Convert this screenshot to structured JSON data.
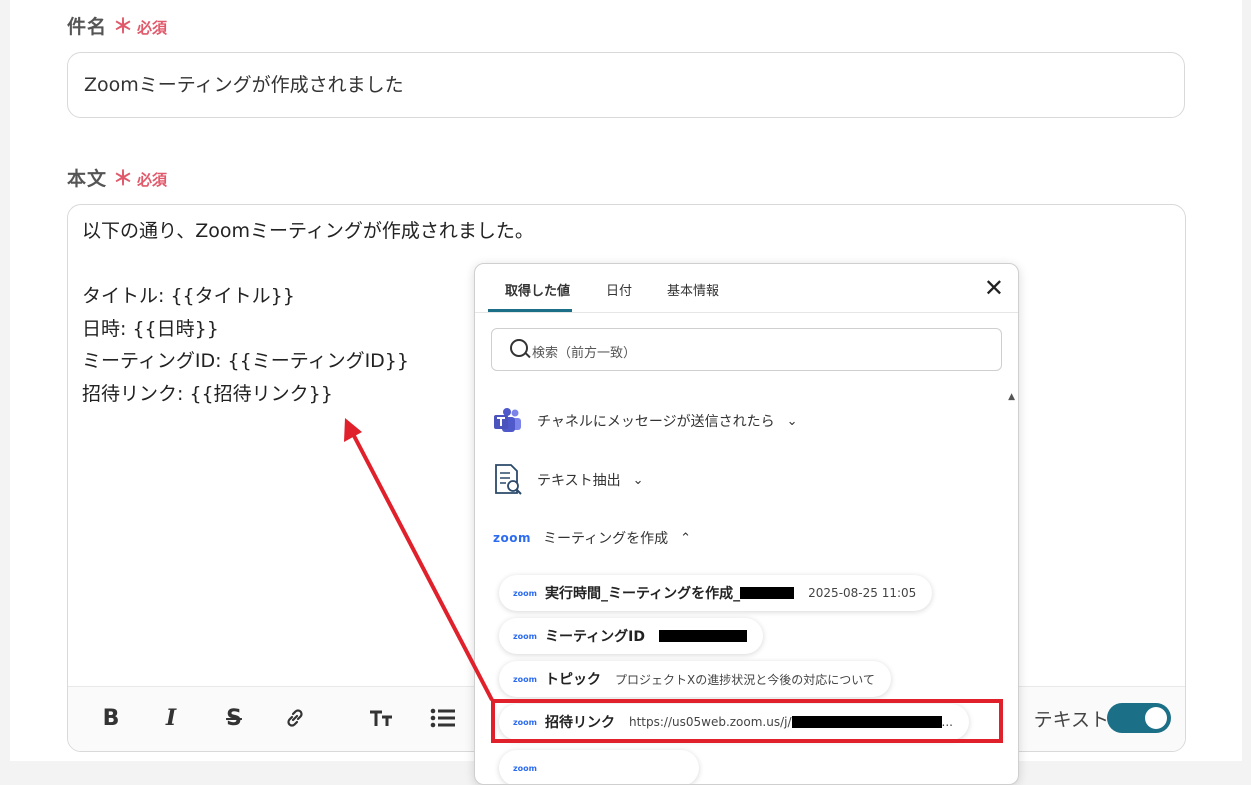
{
  "subject": {
    "label": "件名",
    "required_mark": "＊",
    "required_text": "必須",
    "value": "Zoomミーティングが作成されました"
  },
  "body": {
    "label": "本文",
    "required_mark": "＊",
    "required_text": "必須",
    "lines": [
      "以下の通り、Zoomミーティングが作成されました。",
      "",
      "タイトル: {{タイトル}}",
      "日時: {{日時}}",
      "ミーティングID: {{ミーティングID}}",
      "招待リンク: {{招待リンク}}"
    ]
  },
  "toolbar": {
    "bold_label": "B",
    "italic_label": "I",
    "strike_label": "S",
    "rich_text_label": "テキスト",
    "rich_text_on": true
  },
  "popup": {
    "tabs": [
      "取得した値",
      "日付",
      "基本情報"
    ],
    "close_glyph": "✕",
    "search_placeholder": "検索（前方一致）",
    "sections": [
      {
        "icon": "teams-icon",
        "title": "チャネルにメッセージが送信されたら",
        "expanded": false
      },
      {
        "icon": "document-search-icon",
        "title": "テキスト抽出",
        "expanded": false
      },
      {
        "icon": "zoom-logo",
        "logo_text": "zoom",
        "title": "ミーティングを作成",
        "expanded": true
      }
    ],
    "chips": [
      {
        "name": "実行時間_ミーティングを作成_",
        "value": "2025-08-25 11:05"
      },
      {
        "name": "ミーティングID",
        "value": ""
      },
      {
        "name": "トピック",
        "value": "プロジェクトXの進捗状況と今後の対応について"
      },
      {
        "name": "招待リンク",
        "value": "https://us05web.zoom.us/j/",
        "suffix": "..."
      }
    ],
    "chip_logo_text": "zoom"
  },
  "colors": {
    "required": "#e05a6b",
    "accent": "#1b6f87",
    "zoom_blue": "#2d6cf0",
    "highlight_red": "#e0202a"
  }
}
